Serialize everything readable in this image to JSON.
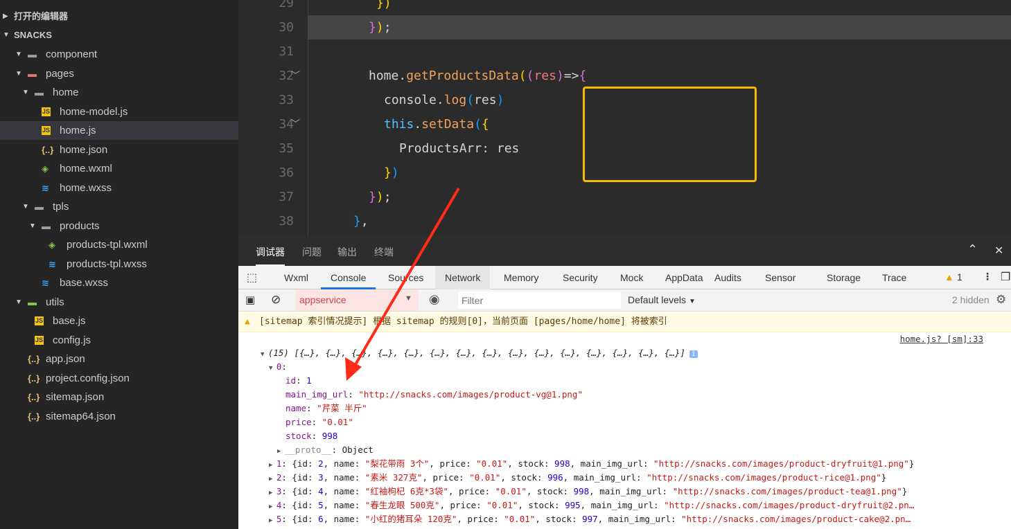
{
  "sidebar": {
    "items": [
      {
        "label": "打开的编辑器",
        "type": "header",
        "depth": 0,
        "arrow": "right"
      },
      {
        "label": "SNACKS",
        "type": "header",
        "depth": 0,
        "arrow": "down"
      },
      {
        "label": "component",
        "type": "folder",
        "depth": 1,
        "arrow": "down"
      },
      {
        "label": "pages",
        "type": "folder-pages",
        "depth": 1,
        "arrow": "down"
      },
      {
        "label": "home",
        "type": "folder",
        "depth": 2,
        "arrow": "down"
      },
      {
        "label": "home-model.js",
        "type": "js",
        "depth": 3
      },
      {
        "label": "home.js",
        "type": "js",
        "depth": 3,
        "selected": true
      },
      {
        "label": "home.json",
        "type": "json",
        "depth": 3
      },
      {
        "label": "home.wxml",
        "type": "wxml",
        "depth": 3
      },
      {
        "label": "home.wxss",
        "type": "wxss",
        "depth": 3
      },
      {
        "label": "tpls",
        "type": "folder",
        "depth": 2,
        "arrow": "down"
      },
      {
        "label": "products",
        "type": "folder",
        "depth": 3,
        "arrow": "down"
      },
      {
        "label": "products-tpl.wxml",
        "type": "wxml",
        "depth": 4
      },
      {
        "label": "products-tpl.wxss",
        "type": "wxss",
        "depth": 4
      },
      {
        "label": "base.wxss",
        "type": "wxss",
        "depth": 3
      },
      {
        "label": "utils",
        "type": "folder-utils",
        "depth": 1,
        "arrow": "down"
      },
      {
        "label": "base.js",
        "type": "js",
        "depth": 2
      },
      {
        "label": "config.js",
        "type": "js",
        "depth": 2
      },
      {
        "label": "app.json",
        "type": "json",
        "depth": 1
      },
      {
        "label": "project.config.json",
        "type": "json",
        "depth": 1
      },
      {
        "label": "sitemap.json",
        "type": "json",
        "depth": 1
      },
      {
        "label": "sitemap64.json",
        "type": "json",
        "depth": 1
      }
    ]
  },
  "editor": {
    "lines": [
      {
        "num": "29",
        "indent": 5,
        "tokens": [
          [
            "})",
            "t-y"
          ]
        ]
      },
      {
        "num": "30",
        "indent": 4,
        "current": true,
        "tokens": [
          [
            "}",
            "t-p"
          ],
          [
            ")",
            "t-y"
          ],
          [
            ";",
            "t-def"
          ]
        ]
      },
      {
        "num": "31",
        "indent": 0,
        "tokens": []
      },
      {
        "num": "32",
        "indent": 4,
        "fold": true,
        "tokens": [
          [
            "home.",
            "t-def"
          ],
          [
            "getProductsData",
            "t-fn"
          ],
          [
            "(",
            "t-y"
          ],
          [
            "(",
            "t-p"
          ],
          [
            "res",
            "t-var"
          ],
          [
            ")",
            "t-p"
          ],
          [
            "=>",
            "t-def"
          ],
          [
            "{",
            "t-p"
          ]
        ]
      },
      {
        "num": "33",
        "indent": 6,
        "tokens": [
          [
            "console.",
            "t-def"
          ],
          [
            "log",
            "t-fn"
          ],
          [
            "(",
            "t-b"
          ],
          [
            "res",
            "t-def"
          ],
          [
            ")",
            "t-b"
          ]
        ]
      },
      {
        "num": "34",
        "indent": 6,
        "fold": true,
        "tokens": [
          [
            "this",
            "t-kw"
          ],
          [
            ".",
            "t-def"
          ],
          [
            "setData",
            "t-fn"
          ],
          [
            "(",
            "t-b"
          ],
          [
            "{",
            "t-y"
          ]
        ]
      },
      {
        "num": "35",
        "indent": 8,
        "tokens": [
          [
            "ProductsArr: res",
            "t-def"
          ]
        ]
      },
      {
        "num": "36",
        "indent": 6,
        "tokens": [
          [
            "}",
            "t-y"
          ],
          [
            ")",
            "t-b"
          ]
        ]
      },
      {
        "num": "37",
        "indent": 4,
        "tokens": [
          [
            "}",
            "t-p"
          ],
          [
            ")",
            "t-y"
          ],
          [
            ";",
            "t-def"
          ]
        ]
      },
      {
        "num": "38",
        "indent": 2,
        "tokens": [
          [
            "}",
            "t-b"
          ],
          [
            ",",
            "t-def"
          ]
        ]
      }
    ]
  },
  "devtools": {
    "top_tabs": [
      "调试器",
      "问题",
      "输出",
      "终端"
    ],
    "panel_tabs": [
      "Wxml",
      "Console",
      "Sources",
      "Network",
      "Memory",
      "Security",
      "Mock",
      "AppData",
      "Audits",
      "Sensor",
      "Storage",
      "Trace"
    ],
    "active_panel": "Console",
    "warning_count": "1",
    "context": "appservice",
    "filter_placeholder": "Filter",
    "levels": "Default levels",
    "hidden": "2 hidden",
    "warning_text": "[sitemap 索引情况提示] 根据 sitemap 的规则[0]，当前页面 [pages/home/home] 将被索引",
    "source_link": "home.js? [sm]:33",
    "console_rows": [
      {
        "indent": 0,
        "arrow": "▼",
        "tokens": [
          [
            "(15) [{…}, {…}, {…}, {…}, {…}, {…}, {…}, {…}, {…}, {…}, {…}, {…}, {…}, {…}, {…}]",
            ""
          ]
        ],
        "info": true
      },
      {
        "indent": 1,
        "arrow": "▼",
        "tokens": [
          [
            "0",
            "k"
          ],
          [
            ":",
            ""
          ]
        ]
      },
      {
        "indent": 3,
        "tokens": [
          [
            "id",
            "k"
          ],
          [
            ": ",
            ""
          ],
          [
            "1",
            "n"
          ]
        ]
      },
      {
        "indent": 3,
        "tokens": [
          [
            "main_img_url",
            "k"
          ],
          [
            ": ",
            ""
          ],
          [
            "\"http://snacks.com/images/product-vg@1.png\"",
            "s"
          ]
        ]
      },
      {
        "indent": 3,
        "tokens": [
          [
            "name",
            "k"
          ],
          [
            ": ",
            ""
          ],
          [
            "\"芹菜 半斤\"",
            "s"
          ]
        ]
      },
      {
        "indent": 3,
        "tokens": [
          [
            "price",
            "k"
          ],
          [
            ": ",
            ""
          ],
          [
            "\"0.01\"",
            "s"
          ]
        ]
      },
      {
        "indent": 3,
        "tokens": [
          [
            "stock",
            "k"
          ],
          [
            ": ",
            ""
          ],
          [
            "998",
            "n"
          ]
        ]
      },
      {
        "indent": 2,
        "arrow": "▶",
        "tokens": [
          [
            "__proto__",
            "g"
          ],
          [
            ": Object",
            ""
          ]
        ]
      },
      {
        "indent": 1,
        "arrow": "▶",
        "tokens": [
          [
            "1",
            "k"
          ],
          [
            ": {id: ",
            ""
          ],
          [
            "2",
            "n"
          ],
          [
            ", name: ",
            ""
          ],
          [
            "\"梨花带雨 3个\"",
            "s"
          ],
          [
            ", price: ",
            ""
          ],
          [
            "\"0.01\"",
            "s"
          ],
          [
            ", stock: ",
            ""
          ],
          [
            "998",
            "n"
          ],
          [
            ", main_img_url: ",
            ""
          ],
          [
            "\"http://snacks.com/images/product-dryfruit@1.png\"",
            "s"
          ],
          [
            "}",
            ""
          ]
        ]
      },
      {
        "indent": 1,
        "arrow": "▶",
        "tokens": [
          [
            "2",
            "k"
          ],
          [
            ": {id: ",
            ""
          ],
          [
            "3",
            "n"
          ],
          [
            ", name: ",
            ""
          ],
          [
            "\"素米 327克\"",
            "s"
          ],
          [
            ", price: ",
            ""
          ],
          [
            "\"0.01\"",
            "s"
          ],
          [
            ", stock: ",
            ""
          ],
          [
            "996",
            "n"
          ],
          [
            ", main_img_url: ",
            ""
          ],
          [
            "\"http://snacks.com/images/product-rice@1.png\"",
            "s"
          ],
          [
            "}",
            ""
          ]
        ]
      },
      {
        "indent": 1,
        "arrow": "▶",
        "tokens": [
          [
            "3",
            "k"
          ],
          [
            ": {id: ",
            ""
          ],
          [
            "4",
            "n"
          ],
          [
            ", name: ",
            ""
          ],
          [
            "\"红袖枸杞 6克*3袋\"",
            "s"
          ],
          [
            ", price: ",
            ""
          ],
          [
            "\"0.01\"",
            "s"
          ],
          [
            ", stock: ",
            ""
          ],
          [
            "998",
            "n"
          ],
          [
            ", main_img_url: ",
            ""
          ],
          [
            "\"http://snacks.com/images/product-tea@1.png\"",
            "s"
          ],
          [
            "}",
            ""
          ]
        ]
      },
      {
        "indent": 1,
        "arrow": "▶",
        "tokens": [
          [
            "4",
            "k"
          ],
          [
            ": {id: ",
            ""
          ],
          [
            "5",
            "n"
          ],
          [
            ", name: ",
            ""
          ],
          [
            "\"春生龙眼 500克\"",
            "s"
          ],
          [
            ", price: ",
            ""
          ],
          [
            "\"0.01\"",
            "s"
          ],
          [
            ", stock: ",
            ""
          ],
          [
            "995",
            "n"
          ],
          [
            ", main_img_url: ",
            ""
          ],
          [
            "\"http://snacks.com/images/product-dryfruit@2.pn…",
            "s"
          ]
        ]
      },
      {
        "indent": 1,
        "arrow": "▶",
        "tokens": [
          [
            "5",
            "k"
          ],
          [
            ": {id: ",
            ""
          ],
          [
            "6",
            "n"
          ],
          [
            ", name: ",
            ""
          ],
          [
            "\"小红的猪耳朵 120克\"",
            "s"
          ],
          [
            ", price: ",
            ""
          ],
          [
            "\"0.01\"",
            "s"
          ],
          [
            ", stock: ",
            ""
          ],
          [
            "997",
            "n"
          ],
          [
            ", main_img_url: ",
            ""
          ],
          [
            "\"http://snacks.com/images/product-cake@2.pn…",
            "s"
          ]
        ]
      }
    ]
  },
  "colors": {
    "highlight_box": "#f9b700",
    "annotation_arrow": "#ff2a1a",
    "active_tab": "#1a73e8"
  }
}
